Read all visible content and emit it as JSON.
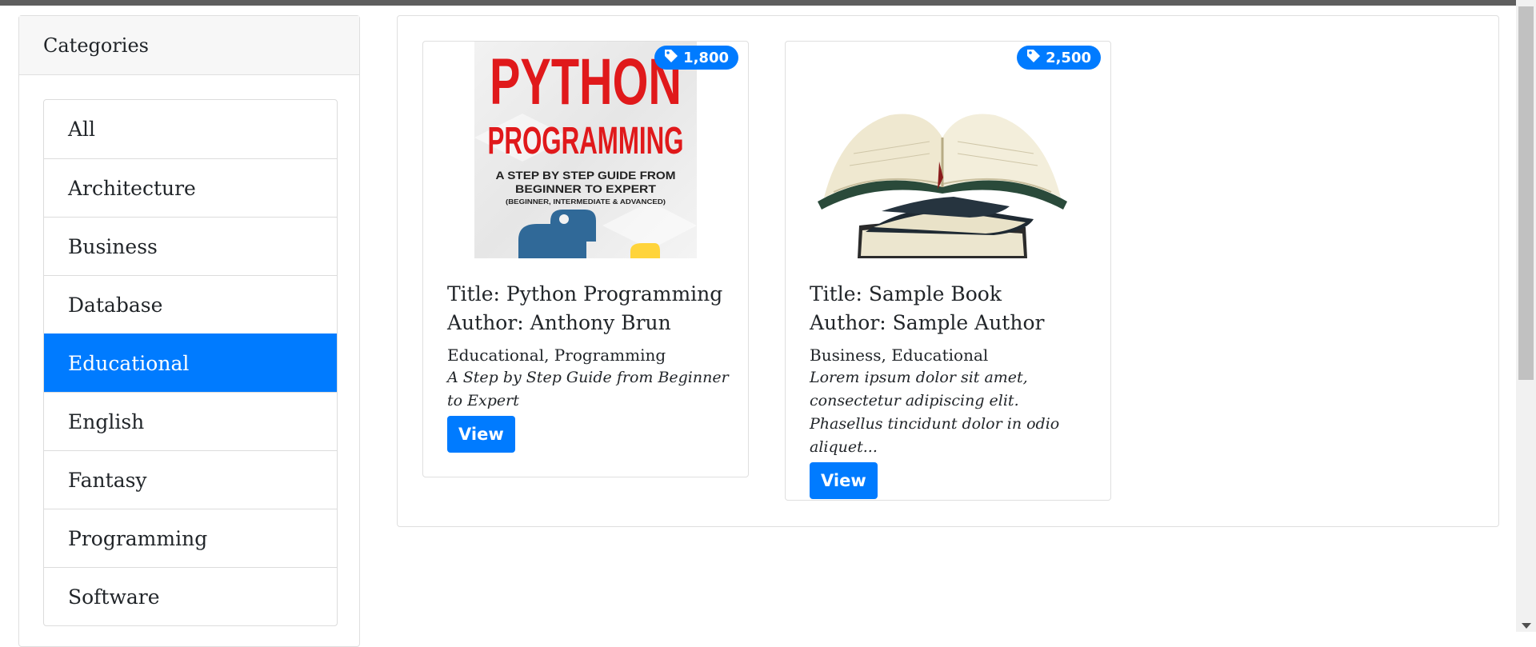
{
  "sidebar": {
    "header": "Categories",
    "items": [
      {
        "label": "All"
      },
      {
        "label": "Architecture"
      },
      {
        "label": "Business"
      },
      {
        "label": "Database"
      },
      {
        "label": "Educational",
        "active": true
      },
      {
        "label": "English"
      },
      {
        "label": "Fantasy"
      },
      {
        "label": "Programming"
      },
      {
        "label": "Software"
      }
    ]
  },
  "books": [
    {
      "price": "1,800",
      "cover": {
        "title_line1": "PYTHON",
        "title_line2": "PROGRAMMING",
        "subtitle_line1": "A STEP BY STEP GUIDE FROM",
        "subtitle_line2": "BEGINNER TO EXPERT",
        "subtitle_line3": "(BEGINNER, INTERMEDIATE & ADVANCED)"
      },
      "title": "Title: Python Programming",
      "author": "Author: Anthony Brun",
      "categories": "Educational, Programming",
      "description": "A Step by Step Guide from Beginner to Expert",
      "button": "View"
    },
    {
      "price": "2,500",
      "title": "Title: Sample Book",
      "author": "Author: Sample Author",
      "categories": "Business, Educational",
      "description": "Lorem ipsum dolor sit amet, consectetur adipiscing elit. Phasellus tincidunt dolor in odio aliquet...",
      "button": "View"
    }
  ],
  "colors": {
    "accent": "#007bff",
    "cover_red": "#e0191b"
  },
  "icons": {
    "price": "tag-icon"
  }
}
